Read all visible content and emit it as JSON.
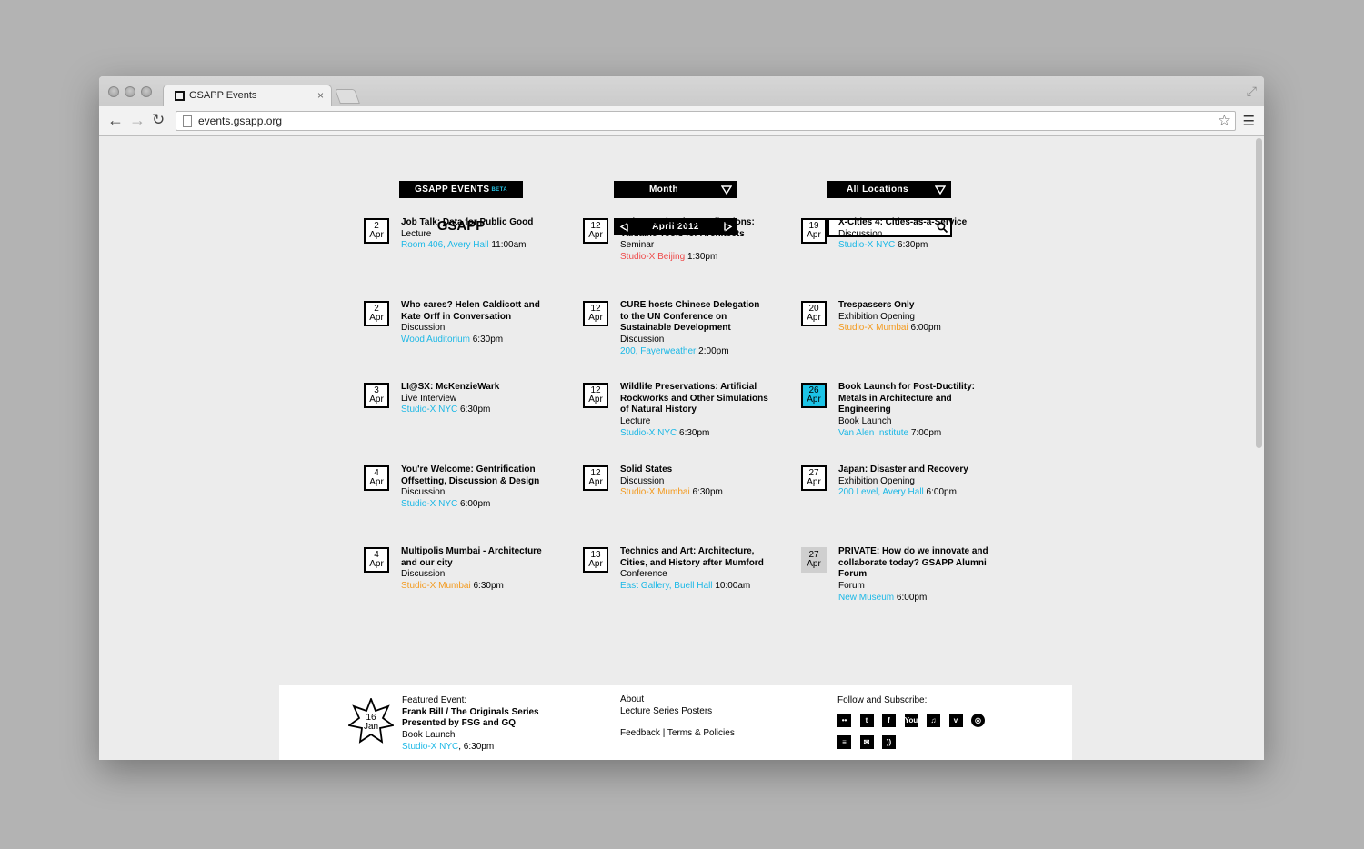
{
  "browser": {
    "tab_title": "GSAPP Events",
    "tab_close": "×",
    "url": "events.gsapp.org"
  },
  "header": {
    "brand": "GSAPP EVENTS",
    "beta": "BETA",
    "view_select": "Month",
    "location_select": "All Locations",
    "logo": "GSAPP",
    "current_month": "April 2012",
    "search_value": ""
  },
  "events": [
    {
      "day": "2",
      "month": "Apr",
      "title": "Job Talk: Data for Public Good",
      "type": "Lecture",
      "location": "Room 406, Avery Hall",
      "location_color": "blue",
      "time": "11:00am",
      "state": ""
    },
    {
      "day": "2",
      "month": "Apr",
      "title": "Who cares? Helen Caldicott and Kate Orff in Conversation",
      "type": "Discussion",
      "location": "Wood Auditorium",
      "location_color": "blue",
      "time": "6:30pm",
      "state": ""
    },
    {
      "day": "3",
      "month": "Apr",
      "title": "LI@SX: McKenzieWark",
      "type": "Live Interview",
      "location": "Studio-X NYC",
      "location_color": "blue",
      "time": "6:30pm",
      "state": ""
    },
    {
      "day": "4",
      "month": "Apr",
      "title": "You're Welcome: Gentrification Offsetting, Discussion & Design",
      "type": "Discussion",
      "location": "Studio-X NYC",
      "location_color": "blue",
      "time": "6:00pm",
      "state": ""
    },
    {
      "day": "4",
      "month": "Apr",
      "title": "Multipolis Mumbai - Architecture and our city",
      "type": "Discussion",
      "location": "Studio-X Mumbai",
      "location_color": "orange",
      "time": "6:30pm",
      "state": ""
    },
    {
      "day": "12",
      "month": "Apr",
      "title": "Colour and Colour Collections: Valuable Tools for Architects",
      "type": "Seminar",
      "location": "Studio-X Beijing",
      "location_color": "red",
      "time": "1:30pm",
      "state": ""
    },
    {
      "day": "12",
      "month": "Apr",
      "title": "CURE hosts Chinese Delegation to the UN Conference on Sustainable Development",
      "type": "Discussion",
      "location": "200, Fayerweather",
      "location_color": "blue",
      "time": "2:00pm",
      "state": ""
    },
    {
      "day": "12",
      "month": "Apr",
      "title": "Wildlife Preservations: Artificial Rockworks and Other Simulations of Natural History",
      "type": "Lecture",
      "location": "Studio-X NYC",
      "location_color": "blue",
      "time": "6:30pm",
      "state": ""
    },
    {
      "day": "12",
      "month": "Apr",
      "title": "Solid States",
      "type": "Discussion",
      "location": "Studio-X Mumbai",
      "location_color": "orange",
      "time": "6:30pm",
      "state": ""
    },
    {
      "day": "13",
      "month": "Apr",
      "title": "Technics and Art: Architecture, Cities, and History after Mumford",
      "type": "Conference",
      "location": "East Gallery, Buell Hall",
      "location_color": "blue",
      "time": "10:00am",
      "state": ""
    },
    {
      "day": "19",
      "month": "Apr",
      "title": "X-Cities 4: Cities-as-a-Service",
      "type": "Discussion",
      "location": "Studio-X NYC",
      "location_color": "blue",
      "time": "6:30pm",
      "state": ""
    },
    {
      "day": "20",
      "month": "Apr",
      "title": "Trespassers Only",
      "type": "Exhibition Opening",
      "location": "Studio-X Mumbai",
      "location_color": "orange",
      "time": "6:00pm",
      "state": ""
    },
    {
      "day": "26",
      "month": "Apr",
      "title": "Book Launch for Post-Ductility: Metals in Architecture and Engineering",
      "type": "Book Launch",
      "location": "Van Alen Institute",
      "location_color": "blue",
      "time": "7:00pm",
      "state": "today"
    },
    {
      "day": "27",
      "month": "Apr",
      "title": "Japan: Disaster and Recovery",
      "type": "Exhibition Opening",
      "location": "200 Level, Avery Hall",
      "location_color": "blue",
      "time": "6:00pm",
      "state": ""
    },
    {
      "day": "27",
      "month": "Apr",
      "title": "PRIVATE: How do we innovate and collaborate today? GSAPP Alumni Forum",
      "type": "Forum",
      "location": "New Museum",
      "location_color": "blue",
      "time": "6:00pm",
      "state": "private"
    }
  ],
  "footer": {
    "featured_label": "Featured Event:",
    "featured_day": "16",
    "featured_month": "Jan",
    "featured_title": "Frank Bill / The Originals Series Presented by FSG and GQ",
    "featured_type": "Book Launch",
    "featured_location": "Studio-X NYC",
    "featured_time": ", 6:30pm",
    "about": "About",
    "posters": "Lecture Series Posters",
    "feedback": "Feedback",
    "separator": " | ",
    "terms": "Terms & Policies",
    "follow": "Follow and Subscribe:",
    "social_icons": [
      "flickr-icon",
      "tumblr-icon",
      "facebook-icon",
      "youtube-icon",
      "itunes-icon",
      "vimeo-icon",
      "gsapp-icon",
      "news-icon",
      "email-icon",
      "rss-icon"
    ]
  },
  "colors": {
    "accent_blue": "#1cb8e6",
    "today_highlight": "#1cc3e6",
    "studio_beijing": "#ee4a4a",
    "studio_mumbai": "#f39a1e"
  }
}
